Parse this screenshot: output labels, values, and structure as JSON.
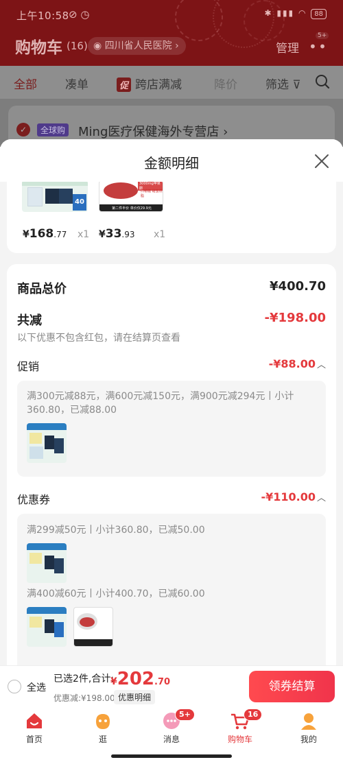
{
  "status_bar": {
    "time": "上午10:58",
    "battery": "88"
  },
  "header": {
    "title": "购物车",
    "count": "(16)",
    "location": "四川省人民医院",
    "manage": "管理",
    "more_badge": "5+"
  },
  "filter_tabs": [
    {
      "label": "全部"
    },
    {
      "label": "凑单"
    },
    {
      "label": "跨店满减",
      "tag": "促"
    },
    {
      "label": "降价"
    },
    {
      "label": "筛选"
    }
  ],
  "store": {
    "badge": "全球购",
    "name": "Ming医疗保健海外专营店 ›"
  },
  "sheet": {
    "title": "金额明细",
    "products": [
      {
        "yen": "¥",
        "int": "168",
        "dec": ".77",
        "qty": "x1",
        "thumb_text": "40"
      },
      {
        "yen": "¥",
        "int": "33",
        "dec": ".93",
        "qty": "x1",
        "thumb_text": "第二件半价 单价仅29.9元",
        "thumb_tag": "3000mg苹果醋",
        "thumb_sub": "口嚼糖 甜蜜燃脂"
      }
    ],
    "total_label": "商品总价",
    "total_value": "¥400.70",
    "discount_label": "共减",
    "discount_value": "-¥198.00",
    "discount_note": "以下优惠不包含红包，请在结算页查看",
    "promotion": {
      "label": "促销",
      "value": "-¥88.00",
      "rule_line1": "满300元减88元，满600元减150元，满900元减294元丨小计",
      "rule_line2": "360.80，已减88.00"
    },
    "coupon": {
      "label": "优惠券",
      "value": "-¥110.00",
      "rule1": "满299减50元丨小计360.80，已减50.00",
      "rule2": "满400减60元丨小计400.70，已减60.00"
    }
  },
  "checkout": {
    "select_all": "全选",
    "selected_text": "已选2件,合计:",
    "total_yen": "¥",
    "total_int": "202",
    "total_dec": ".70",
    "discount_text": "优惠减:¥198.00",
    "detail_link": "优惠明细",
    "button": "领券结算"
  },
  "tabbar": [
    {
      "label": "首页"
    },
    {
      "label": "逛"
    },
    {
      "label": "消息",
      "badge": "5+"
    },
    {
      "label": "购物车",
      "badge": "16"
    },
    {
      "label": "我的"
    }
  ],
  "colors": {
    "accent": "#e4393c",
    "header_bg_dim": "#7d1416"
  }
}
